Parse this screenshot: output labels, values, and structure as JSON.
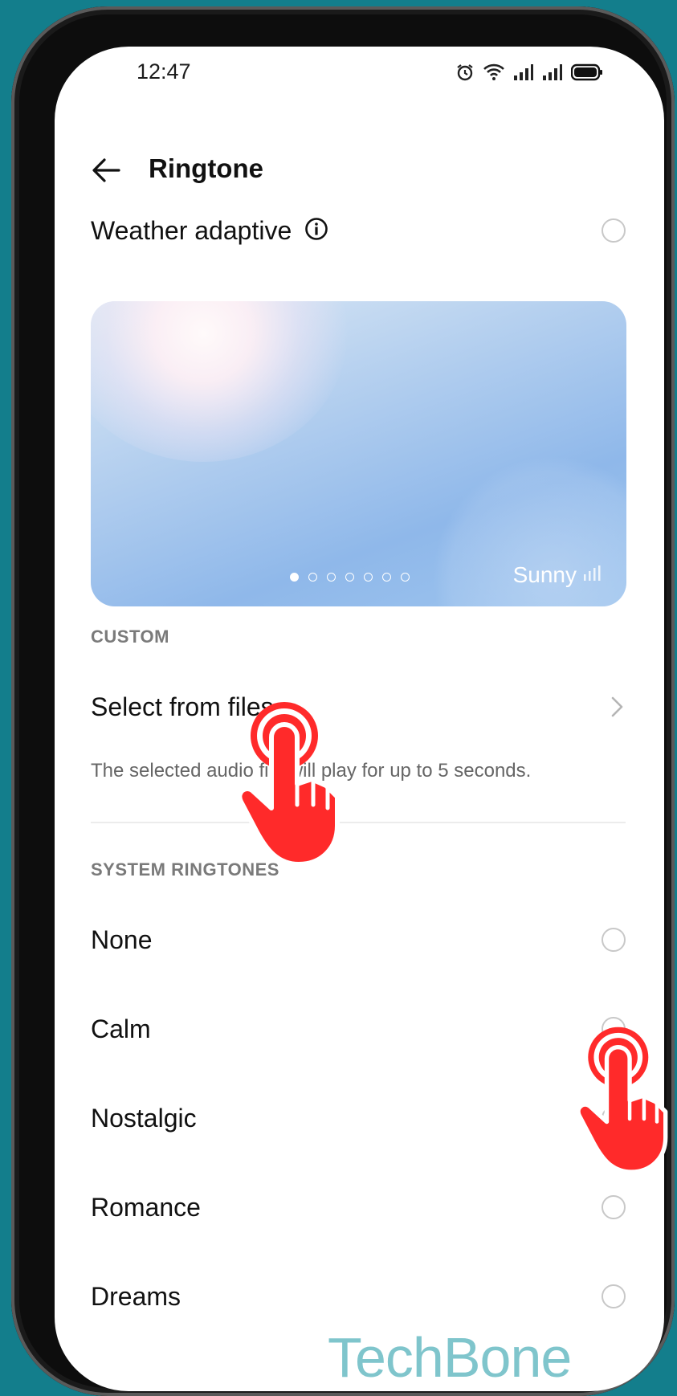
{
  "status_bar": {
    "time": "12:47"
  },
  "app_bar": {
    "title": "Ringtone"
  },
  "weather_adaptive": {
    "label": "Weather adaptive"
  },
  "weather_card": {
    "condition": "Sunny",
    "page_count": 7,
    "active_page": 1
  },
  "custom": {
    "header": "CUSTOM",
    "select_from_files": "Select from files",
    "description": "The selected audio file will play for up to 5 seconds."
  },
  "system_ringtones": {
    "header": "SYSTEM RINGTONES",
    "items": [
      "None",
      "Calm",
      "Nostalgic",
      "Romance",
      "Dreams"
    ]
  },
  "watermark": "TechBone",
  "colors": {
    "background": "#137e8c",
    "accent_hand": "#ff2a2a",
    "watermark": "#7fc5cc"
  }
}
